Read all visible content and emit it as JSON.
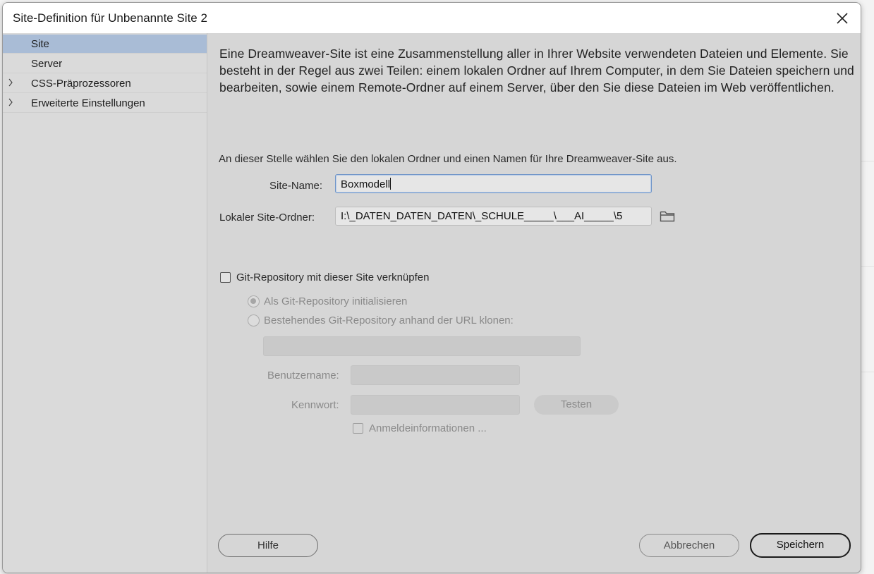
{
  "window": {
    "title": "Site-Definition für Unbenannte Site 2",
    "close_icon": "close-icon"
  },
  "sidebar": {
    "items": [
      {
        "label": "Site",
        "expandable": false,
        "selected": true
      },
      {
        "label": "Server",
        "expandable": false,
        "selected": false
      },
      {
        "label": "CSS-Präprozessoren",
        "expandable": true,
        "selected": false
      },
      {
        "label": "Erweiterte Einstellungen",
        "expandable": true,
        "selected": false
      }
    ]
  },
  "content": {
    "intro": "Eine Dreamweaver-Site ist eine Zusammenstellung aller in Ihrer Website verwendeten Dateien und Elemente. Sie besteht in der Regel aus zwei Teilen: einem lokalen Ordner auf Ihrem Computer, in dem Sie Dateien speichern und bearbeiten, sowie einem Remote-Ordner auf einem Server, über den Sie diese Dateien im Web veröffentlichen.",
    "instruction": "An dieser Stelle wählen Sie den lokalen Ordner und einen Namen für Ihre Dreamweaver-Site aus.",
    "site_name": {
      "label": "Site-Name:",
      "value": "Boxmodell"
    },
    "local_folder": {
      "label": "Lokaler Site-Ordner:",
      "value": "I:\\_DATEN_DATEN_DATEN\\_SCHULE_____\\___AI_____\\5",
      "icon": "folder-icon"
    },
    "git": {
      "checkbox_label": "Git-Repository mit dieser Site verknüpfen",
      "checked": false,
      "init_label": "Als Git-Repository initialisieren",
      "clone_label": "Bestehendes Git-Repository anhand der URL klonen:",
      "url_value": "",
      "username_label": "Benutzername:",
      "username_value": "",
      "password_label": "Kennwort:",
      "password_value": "",
      "test_label": "Testen",
      "credentials_label": "Anmeldeinformationen ..."
    }
  },
  "footer": {
    "help_label": "Hilfe",
    "cancel_label": "Abbrechen",
    "save_label": "Speichern"
  }
}
